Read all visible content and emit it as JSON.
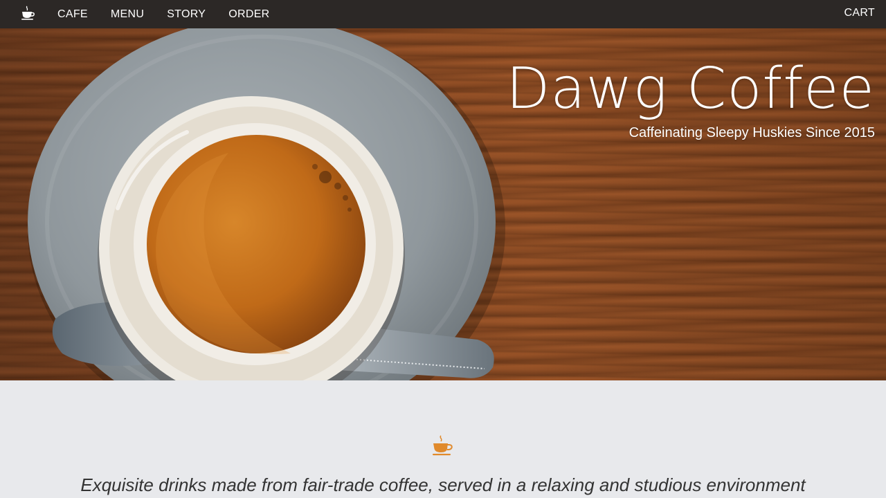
{
  "navbar": {
    "brand_icon": "coffee-cup-icon",
    "links": [
      "CAFE",
      "MENU",
      "STORY",
      "ORDER"
    ],
    "cart_label": "CART"
  },
  "hero": {
    "title": "Dawg Coffee",
    "subtitle": "Caffeinating Sleepy Huskies Since 2015"
  },
  "intro": {
    "icon": "coffee-cup-icon",
    "icon_color": "#e08a2c",
    "tagline": "Exquisite drinks made from fair-trade coffee, served in a relaxing and studious environment"
  },
  "colors": {
    "navbar_bg": "#2c2826",
    "section_bg": "#e8e9ec",
    "accent": "#e08a2c"
  }
}
